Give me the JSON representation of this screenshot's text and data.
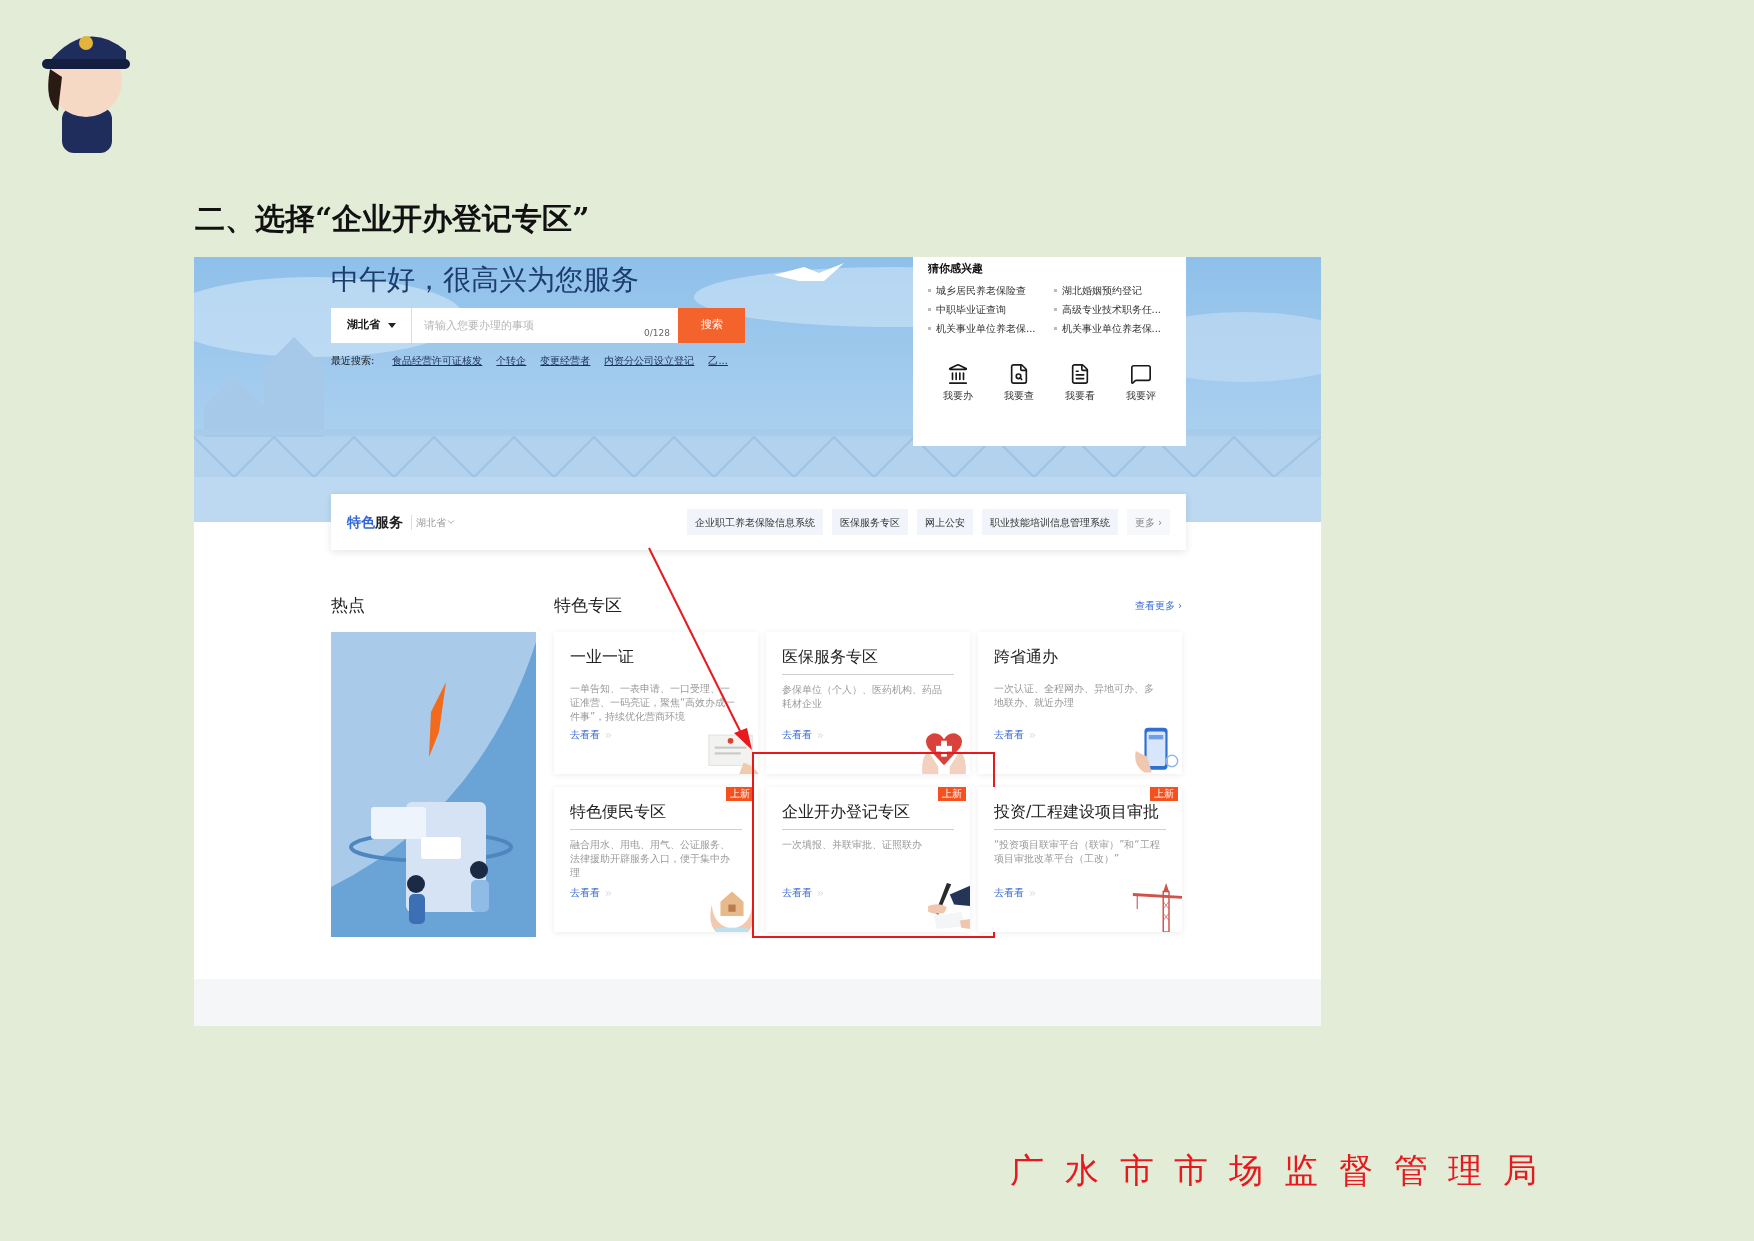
{
  "heading": "二、选择“企业开办登记专区”",
  "portal": {
    "greeting": "中午好，很高兴为您服务",
    "search": {
      "region": "湖北省",
      "placeholder": "请输入您要办理的事项",
      "counter": "0/128",
      "button": "搜索"
    },
    "recent": {
      "label": "最近搜索:",
      "links": [
        "食品经营许可证核发",
        "个转企",
        "变更经营者",
        "内资分公司设立登记",
        "乙..."
      ]
    },
    "interest": {
      "title": "猜你感兴趣",
      "items": [
        "城乡居民养老保险查",
        "湖北婚姻预约登记",
        "中职毕业证查询",
        "高级专业技术职务任...",
        "机关事业单位养老保...",
        "机关事业单位养老保..."
      ],
      "actions": [
        {
          "kind": "do",
          "label": "我要办"
        },
        {
          "kind": "query",
          "label": "我要查"
        },
        {
          "kind": "view",
          "label": "我要看"
        },
        {
          "kind": "rate",
          "label": "我要评"
        }
      ]
    },
    "services_bar": {
      "title_accent": "特色",
      "title": "服务",
      "region": "湖北省",
      "tags": [
        "企业职工养老保险信息系统",
        "医保服务专区",
        "网上公安",
        "职业技能培训信息管理系统"
      ],
      "more": "更多 ›"
    },
    "hot": {
      "title": "热点"
    },
    "zone": {
      "title": "特色专区",
      "more": "查看更多 ›",
      "cards": [
        {
          "title": "一业一证",
          "desc": "一单告知、一表申请、一口受理、一证准营、一码亮证，聚焦“高效办成一件事”，持续优化营商环境",
          "link": "去看看",
          "underlined": false,
          "highlighted": false
        },
        {
          "title": "医保服务专区",
          "desc": "参保单位（个人）、医药机构、药品耗材企业",
          "link": "去看看",
          "underlined": true,
          "highlighted": false
        },
        {
          "title": "跨省通办",
          "desc": "一次认证、全程网办、异地可办、多地联办、就近办理",
          "link": "去看看",
          "underlined": false,
          "highlighted": false
        },
        {
          "title": "特色便民专区",
          "desc": "融合用水、用电、用气、公证服务、法律援助开辟服务入口，便于集中办理",
          "link": "去看看",
          "underlined": true,
          "badge": "上新",
          "highlighted": false
        },
        {
          "title": "企业开办登记专区",
          "desc": "一次填报、并联审批、证照联办",
          "link": "去看看",
          "underlined": true,
          "badge": "上新",
          "highlighted": true
        },
        {
          "title": "投资/工程建设项目审批",
          "desc": "“投资项目联审平台（联审）”和“工程项目审批改革平台（工改）”",
          "link": "去看看",
          "underlined": true,
          "badge": "上新",
          "highlighted": false
        }
      ]
    }
  },
  "footer": "广 水 市 市 场 监 督 管 理 局"
}
